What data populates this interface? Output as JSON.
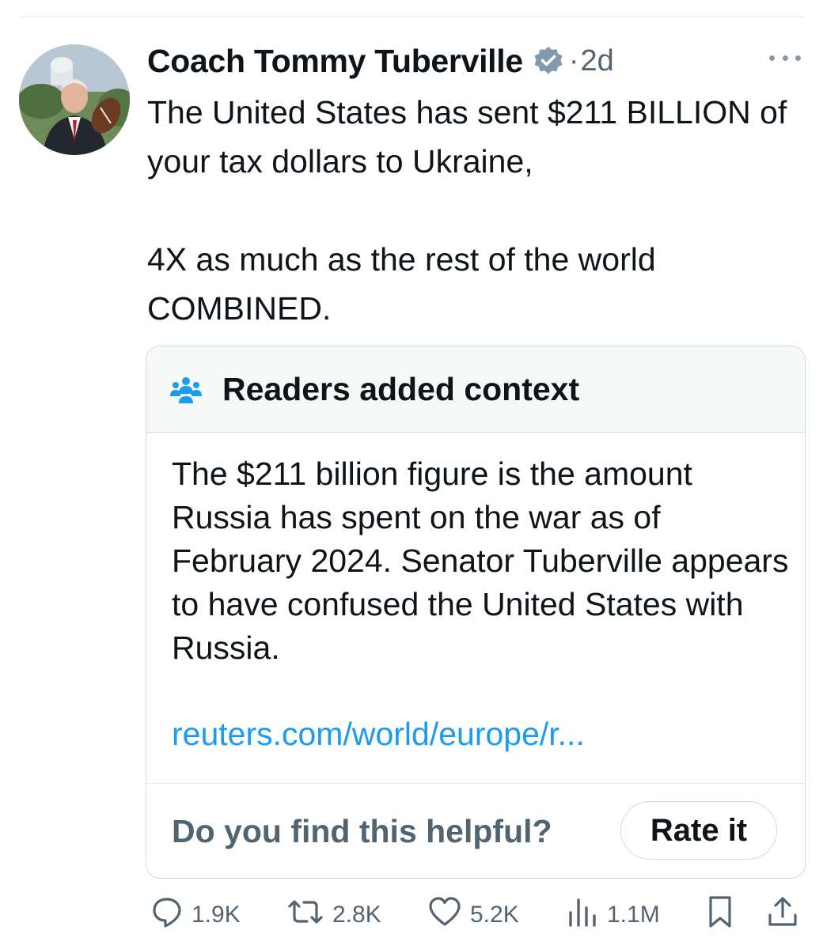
{
  "tweet": {
    "author_name": "Coach Tommy Tuberville",
    "separator": "·",
    "time": "2d",
    "text_paragraphs": [
      "The United States has sent $211 BILLION of your tax dollars to Ukraine,",
      "4X as much as the rest of the world COMBINED."
    ]
  },
  "note": {
    "header": "Readers added context",
    "body": "The $211 billion figure is the amount Russia has spent on the war as of February 2024. Senator Tuberville appears to have confused the United States with Russia.",
    "link": "reuters.com/world/europe/r...",
    "helpful_prompt": "Do you find this helpful?",
    "rate_label": "Rate it"
  },
  "actions": {
    "reply_count": "1.9K",
    "repost_count": "2.8K",
    "like_count": "5.2K",
    "views_count": "1.1M"
  },
  "icons": {
    "verified": "verified-badge-icon",
    "more": "more-icon",
    "community": "community-notes-icon",
    "reply": "reply-icon",
    "repost": "repost-icon",
    "like": "like-icon",
    "views": "views-icon",
    "bookmark": "bookmark-icon",
    "share": "share-icon"
  },
  "colors": {
    "text": "#0f1419",
    "secondary": "#536471",
    "link": "#1d9bf0",
    "border": "#cfd9de"
  }
}
